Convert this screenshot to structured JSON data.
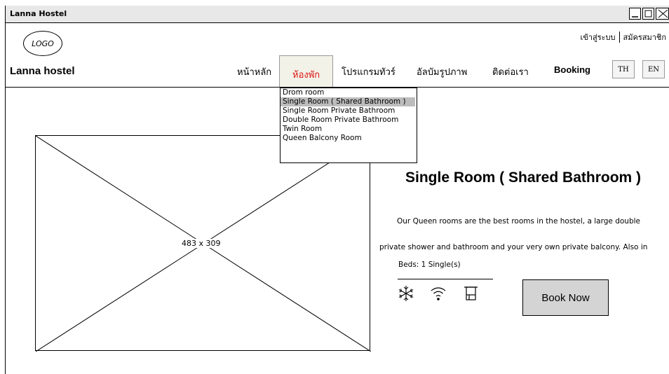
{
  "window": {
    "title": "Lanna Hostel"
  },
  "header": {
    "logo_text": "LOGO",
    "brand": "Lanna hostel",
    "login": "เข้าสู่ระบบ",
    "register": "สมัครสมาชิก"
  },
  "nav": {
    "items": [
      "หน้าหลัก",
      "ห้องพัก",
      "โปรแกรมทัวร์",
      "อัลบัมรูปภาพ",
      "ติดต่อเรา",
      "Booking"
    ],
    "active": "ห้องพัก",
    "lang": [
      "TH",
      "EN"
    ]
  },
  "dropdown": {
    "items": [
      "Drom room",
      "Single Room ( Shared Bathroom )",
      "Single Room Private Bathroom",
      "Double Room Private Bathroom",
      "Twin Room",
      "Queen Balcony Room"
    ],
    "selected": "Single Room ( Shared Bathroom )"
  },
  "main": {
    "image_label": "483 x 309",
    "room_title": "Single Room ( Shared Bathroom )",
    "desc_line1": "Our Queen rooms are the best rooms in the hostel,  a large double",
    "desc_line2": "private shower and bathroom and your very own private balcony. Also in",
    "beds": "Beds: 1 Single(s)",
    "amenity_icons": [
      "snowflake-icon",
      "wifi-icon",
      "towel-icon"
    ],
    "book_button": "Book Now"
  }
}
